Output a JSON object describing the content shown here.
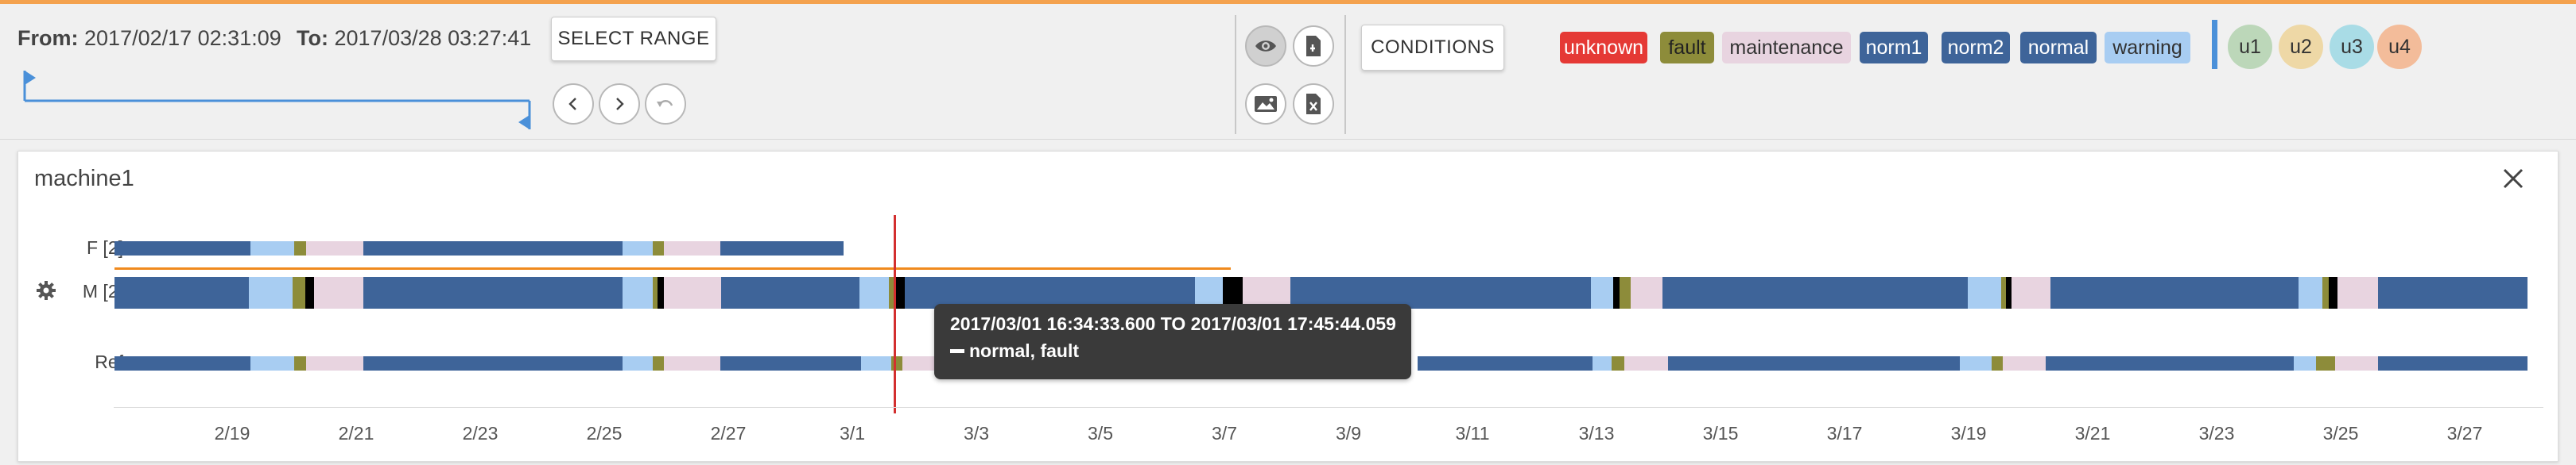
{
  "range": {
    "from_label": "From:",
    "from_value": "2017/02/17 02:31:09",
    "to_label": "To:",
    "to_value": "2017/03/28 03:27:41",
    "select_button": "SELECT RANGE"
  },
  "toolbar": {
    "conditions_button": "CONDITIONS"
  },
  "legend_tags": [
    {
      "label": "unknown",
      "bg": "#e53935",
      "fg": "#ffffff"
    },
    {
      "label": "fault",
      "bg": "#8d8c3a",
      "fg": "#222222"
    },
    {
      "label": "maintenance",
      "bg": "#e8d4e0",
      "fg": "#333333"
    },
    {
      "label": "norm1",
      "bg": "#3e6499",
      "fg": "#ffffff"
    },
    {
      "label": "norm2",
      "bg": "#3e6499",
      "fg": "#ffffff"
    },
    {
      "label": "normal",
      "bg": "#3e6499",
      "fg": "#ffffff"
    },
    {
      "label": "warning",
      "bg": "#a8cdf2",
      "fg": "#333333"
    }
  ],
  "user_tags": [
    {
      "label": "u1",
      "bg": "#bcd7b9"
    },
    {
      "label": "u2",
      "bg": "#eed8a6"
    },
    {
      "label": "u3",
      "bg": "#a9dce6"
    },
    {
      "label": "u4",
      "bg": "#f3bc9a"
    }
  ],
  "panel": {
    "title": "machine1",
    "rows": [
      "F [2]",
      "M [2]",
      "Ref"
    ]
  },
  "axis_ticks": [
    "2/19",
    "2/21",
    "2/23",
    "2/25",
    "2/27",
    "3/1",
    "3/3",
    "3/5",
    "3/7",
    "3/9",
    "3/11",
    "3/13",
    "3/15",
    "3/17",
    "3/19",
    "3/21",
    "3/23",
    "3/25",
    "3/27"
  ],
  "tooltip": {
    "time_range": "2017/03/01 16:34:33.600 TO 2017/03/01 17:45:44.059",
    "state": "normal, fault"
  },
  "colors": {
    "normal": "#3e6499",
    "warning": "#a8cdf2",
    "fault": "#8d8c3a",
    "maintenance": "#e8d4e0",
    "unknown": "#e53935",
    "accent": "#4a90d9",
    "cursor": "#d32f2f",
    "highlight": "#f08a1e"
  }
}
